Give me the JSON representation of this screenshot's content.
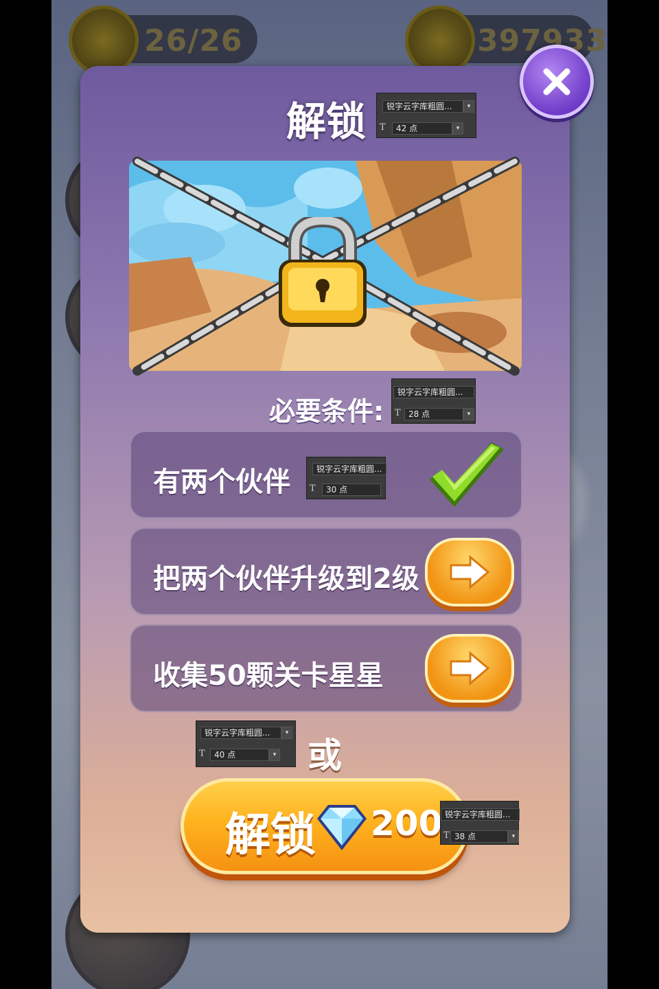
{
  "background": {
    "energy_text": "26/26",
    "gems_text": "397933"
  },
  "dialog": {
    "title": "解锁",
    "requirements_label": "必要条件:",
    "conditions": [
      {
        "text": "有两个伙伴",
        "status": "completed"
      },
      {
        "text": "把两个伙伴升级到2级",
        "status": "go"
      },
      {
        "text": "收集50颗关卡星星",
        "status": "go"
      }
    ],
    "or_label": "或",
    "unlock_button": {
      "label": "解锁",
      "price": "200",
      "icon": "diamond-icon"
    }
  },
  "font_tools": [
    {
      "font": "锐字云字库粗圆...",
      "size": "42 点"
    },
    {
      "font": "锐字云字库粗圆...",
      "size": "28 点"
    },
    {
      "font": "锐字云字库粗圆...",
      "size": "30 点"
    },
    {
      "font": "锐字云字库粗圆...",
      "size": "40 点"
    },
    {
      "font": "锐字云字库粗圆...",
      "size": "38 点"
    }
  ],
  "colors": {
    "dialog_top": "#6e5a9e",
    "dialog_bottom": "#e8c0a2",
    "button_orange": "#ffb21e",
    "close_purple": "#8b55de",
    "check_green": "#7ad21e"
  }
}
